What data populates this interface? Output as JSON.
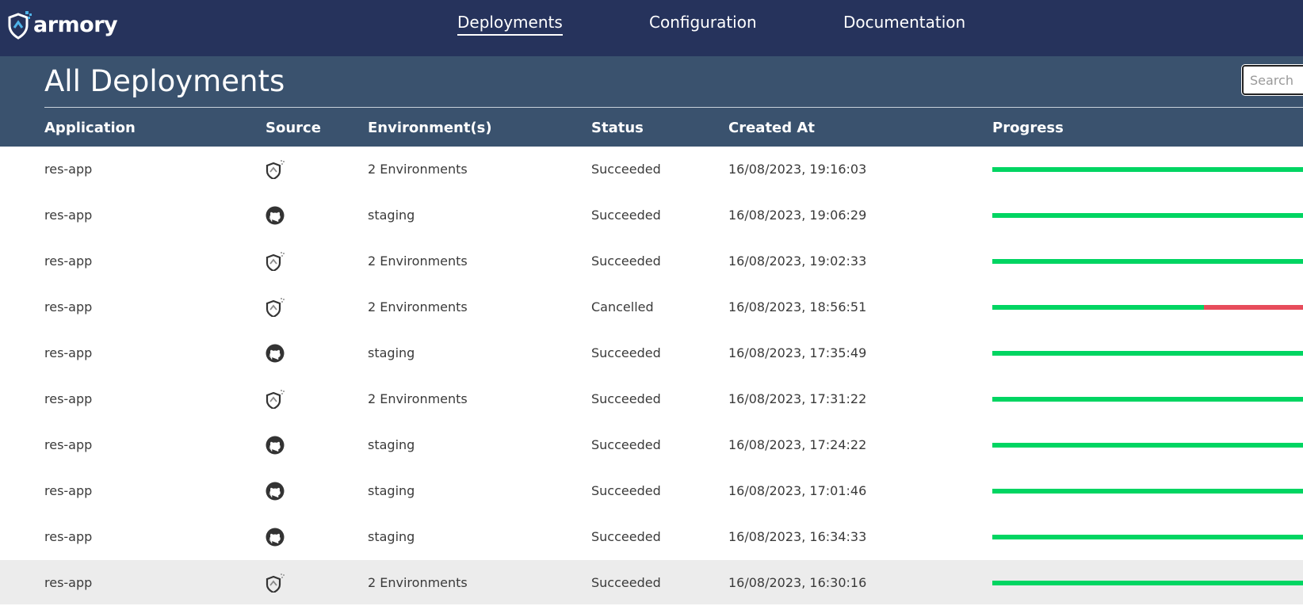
{
  "app": {
    "logo_text": "armory"
  },
  "nav": {
    "items": [
      {
        "label": "Deployments",
        "active": true
      },
      {
        "label": "Configuration",
        "active": false
      },
      {
        "label": "Documentation",
        "active": false
      }
    ]
  },
  "page": {
    "title": "All Deployments"
  },
  "search": {
    "placeholder": "Search",
    "value": ""
  },
  "table": {
    "columns": [
      "Application",
      "Source",
      "Environment(s)",
      "Status",
      "Created At",
      "Progress"
    ],
    "rows": [
      {
        "application": "res-app",
        "source": "armory-icon",
        "environments": "2 Environments",
        "status": "Succeeded",
        "created_at": "16/08/2023, 19:16:03",
        "progress": 1.0
      },
      {
        "application": "res-app",
        "source": "github-icon",
        "environments": "staging",
        "status": "Succeeded",
        "created_at": "16/08/2023, 19:06:29",
        "progress": 1.0
      },
      {
        "application": "res-app",
        "source": "armory-icon",
        "environments": "2 Environments",
        "status": "Succeeded",
        "created_at": "16/08/2023, 19:02:33",
        "progress": 1.0
      },
      {
        "application": "res-app",
        "source": "armory-icon",
        "environments": "2 Environments",
        "status": "Cancelled",
        "created_at": "16/08/2023, 18:56:51",
        "progress": 0.68
      },
      {
        "application": "res-app",
        "source": "github-icon",
        "environments": "staging",
        "status": "Succeeded",
        "created_at": "16/08/2023, 17:35:49",
        "progress": 1.0
      },
      {
        "application": "res-app",
        "source": "armory-icon",
        "environments": "2 Environments",
        "status": "Succeeded",
        "created_at": "16/08/2023, 17:31:22",
        "progress": 1.0
      },
      {
        "application": "res-app",
        "source": "github-icon",
        "environments": "staging",
        "status": "Succeeded",
        "created_at": "16/08/2023, 17:24:22",
        "progress": 1.0
      },
      {
        "application": "res-app",
        "source": "github-icon",
        "environments": "staging",
        "status": "Succeeded",
        "created_at": "16/08/2023, 17:01:46",
        "progress": 1.0
      },
      {
        "application": "res-app",
        "source": "github-icon",
        "environments": "staging",
        "status": "Succeeded",
        "created_at": "16/08/2023, 16:34:33",
        "progress": 1.0
      },
      {
        "application": "res-app",
        "source": "armory-icon",
        "environments": "2 Environments",
        "status": "Succeeded",
        "created_at": "16/08/2023, 16:30:16",
        "progress": 1.0
      }
    ]
  },
  "colors": {
    "topbar": "#26335c",
    "subheader": "#3a526e",
    "progress_success": "#00d562",
    "progress_failed": "#e74c5b",
    "row_hover": "#ececec"
  }
}
